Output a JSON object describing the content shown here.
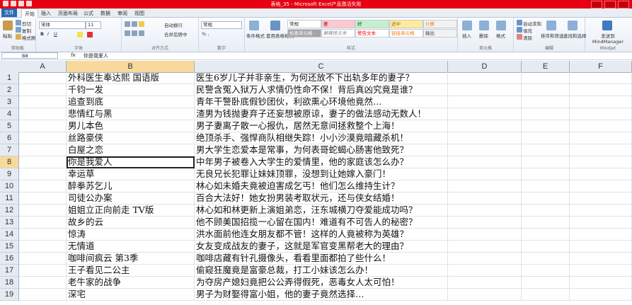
{
  "window": {
    "title": "表格_35 - Microsoft Excel产品激活失败"
  },
  "ribbon_tabs": [
    "文件",
    "开始",
    "插入",
    "页面布局",
    "公式",
    "数据",
    "审阅",
    "视图"
  ],
  "ribbon": {
    "clipboard": {
      "paste": "粘贴",
      "cut": "剪切",
      "copy": "复制",
      "format_painter": "格式刷",
      "label": "剪贴板"
    },
    "font": {
      "name": "宋体",
      "size": "11",
      "label": "字体"
    },
    "alignment": {
      "wrap": "自动换行",
      "merge": "合并后居中",
      "label": "对齐方式"
    },
    "number": {
      "format": "常规",
      "label": "数字"
    },
    "styles": {
      "conditional": "条件格式",
      "table_format": "套用表格格式",
      "cells": [
        "常规",
        "差",
        "好",
        "适中",
        "计算",
        "检查单元格",
        "解释性文本",
        "警告文本",
        "链接单元格",
        "输出"
      ],
      "label": "样式"
    },
    "cells_group": {
      "insert": "插入",
      "delete": "删除",
      "format": "格式",
      "label": "单元格"
    },
    "editing": {
      "sum": "自动求和",
      "fill": "填充",
      "clear": "清除",
      "sort": "排序和筛选",
      "find": "查找和选择",
      "label": "编辑"
    },
    "mindjet": {
      "send": "发送到 MindManager",
      "label": "Mindjet"
    }
  },
  "formula_bar": {
    "name_box": "B8",
    "fx": "fx",
    "content": "你是我爱人"
  },
  "columns": [
    "A",
    "B",
    "C",
    "D",
    "E",
    "F"
  ],
  "rows": [
    {
      "n": "1",
      "b": "外科医生奉达熙  国语版",
      "c": "医生6岁儿子并非亲生，为何还放不下出轨多年的妻子？"
    },
    {
      "n": "2",
      "b": "千钧一发",
      "c": "民警含冤入狱万人求情仍性命不保！背后真凶究竟是谁？"
    },
    {
      "n": "3",
      "b": "追查到底",
      "c": "青年干警卧底假钞团伙，利欲熏心环境他竟然…"
    },
    {
      "n": "4",
      "b": "悲情红与黑",
      "c": "渣男为钱抛妻弃子还妄想被原谅，妻子的做法感动无数人！"
    },
    {
      "n": "5",
      "b": "男儿本色",
      "c": "男子妻离子散一心报仇，居然无意间拯救整个上海！"
    },
    {
      "n": "6",
      "b": "丝路豪侠",
      "c": "绝顶杀手、强悍商队相继失踪！小小沙漠竟暗藏杀机！"
    },
    {
      "n": "7",
      "b": "白屋之恋",
      "c": "男大学生恋爱本是常事，为何表哥蛇蝎心肠害他致死？"
    },
    {
      "n": "8",
      "b": "你是我爱人",
      "c": "中年男子被卷入大学生的爱情里，他的家庭该怎么办？"
    },
    {
      "n": "9",
      "b": "幸运草",
      "c": "无良兄长犯罪让妹妹顶罪，没想到让她嫁入豪门！"
    },
    {
      "n": "10",
      "b": "醉拳苏乞儿",
      "c": "林心如未婚夫竟被迫害成乞丐！他们怎么维持生计？"
    },
    {
      "n": "11",
      "b": "司徒公办案",
      "c": "百合大法好！她女扮男装考取状元，还与侠女结婚！"
    },
    {
      "n": "12",
      "b": "姐姐立正向前走  TV版",
      "c": "林心如和林更新上演姐弟恋，汪东城横刀夺爱能成功吗？"
    },
    {
      "n": "13",
      "b": "故乡的云",
      "c": "他不顾美国招揽一心留在国内！难道有不可告人的秘密？"
    },
    {
      "n": "14",
      "b": "惊涛",
      "c": "洪水面前他连女朋友都不管！这样的人竟被称为英雄？"
    },
    {
      "n": "15",
      "b": "无情道",
      "c": "女友变成战友的妻子，这就是军官变黑帮老大的理由？"
    },
    {
      "n": "16",
      "b": "咖啡间疯云  第3季",
      "c": "咖啡店藏有针孔摄像头，看看里面都拍了些什么！"
    },
    {
      "n": "17",
      "b": "王子看见二公主",
      "c": "偷窥狂魔竟是富豪总裁，打工小妹该怎么办！"
    },
    {
      "n": "18",
      "b": "老牛家的战争",
      "c": "为夺房产媳妇竟把公公弄得假死，恶毒女人太可怕！"
    },
    {
      "n": "19",
      "b": "深宅",
      "c": "男子为财娶得富小姐，他的妻子竟然选择…"
    }
  ],
  "selected": {
    "row": "8",
    "col": "B"
  }
}
